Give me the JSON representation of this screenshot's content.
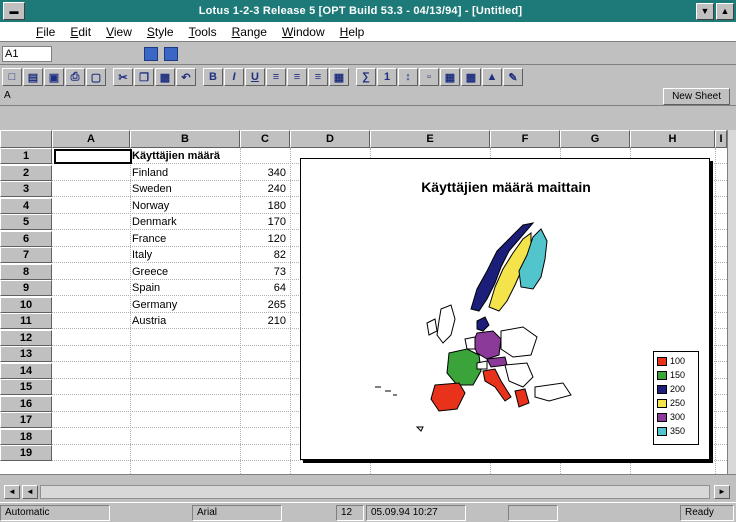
{
  "window": {
    "title": "Lotus 1-2-3 Release 5 [OPT Build 53.3 - 04/13/94] - [Untitled]"
  },
  "menu": [
    "File",
    "Edit",
    "View",
    "Style",
    "Tools",
    "Range",
    "Window",
    "Help"
  ],
  "cellbar": {
    "cell_ref": "A1"
  },
  "toolbar": {
    "new_sheet_label": "New Sheet",
    "sheet_label": "A"
  },
  "columns": [
    "A",
    "B",
    "C",
    "D",
    "E",
    "F",
    "G",
    "H",
    "I"
  ],
  "rows": [
    "1",
    "2",
    "3",
    "4",
    "5",
    "6",
    "7",
    "8",
    "9",
    "10",
    "11",
    "12",
    "13",
    "14",
    "15",
    "16",
    "17",
    "18",
    "19"
  ],
  "sheet": {
    "header": "Käyttäjien määrä",
    "countries": [
      "Finland",
      "Sweden",
      "Norway",
      "Denmark",
      "France",
      "Italy",
      "Greece",
      "Spain",
      "Germany",
      "Austria"
    ],
    "values": [
      "340",
      "240",
      "180",
      "170",
      "120",
      "82",
      "73",
      "64",
      "265",
      "210"
    ]
  },
  "chart": {
    "title": "Käyttäjien määrä maittain",
    "legend": [
      {
        "label": "100",
        "color": "#e8321c"
      },
      {
        "label": "150",
        "color": "#3aa33a"
      },
      {
        "label": "200",
        "color": "#1b1f7a"
      },
      {
        "label": "250",
        "color": "#f4e34a"
      },
      {
        "label": "300",
        "color": "#8b3a9a"
      },
      {
        "label": "350",
        "color": "#52c4cc"
      }
    ]
  },
  "status": {
    "mode": "Automatic",
    "font": "Arial",
    "size": "12",
    "datetime": "05.09.94 10:27",
    "ready": "Ready"
  }
}
